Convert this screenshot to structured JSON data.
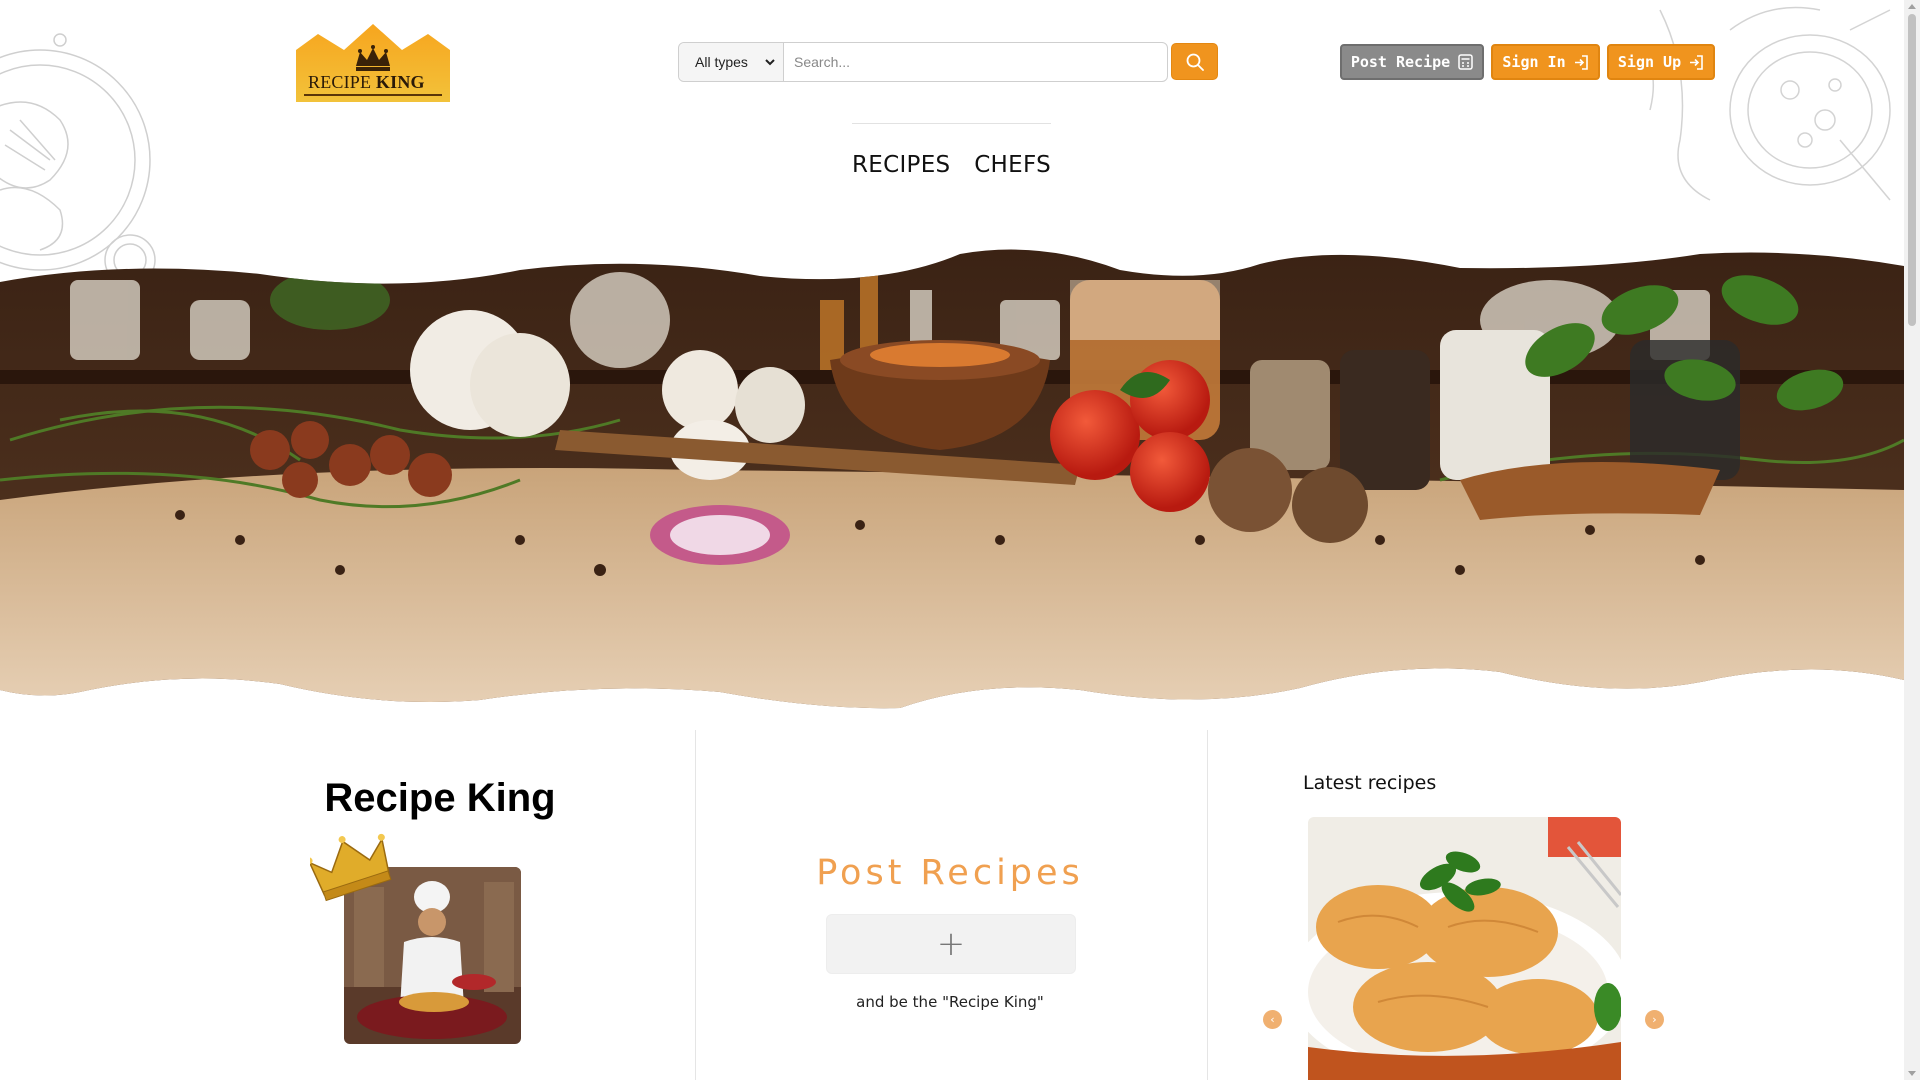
{
  "header": {
    "logo": {
      "word1": "RECIPE",
      "word2": "KING"
    },
    "search": {
      "type_selected": "All types",
      "placeholder": "Search..."
    },
    "buttons": {
      "post_recipe": "Post Recipe",
      "sign_in": "Sign In",
      "sign_up": "Sign Up"
    }
  },
  "nav": {
    "items": [
      {
        "label": "RECIPES"
      },
      {
        "label": "CHEFS"
      }
    ]
  },
  "about": {
    "title": "Recipe King"
  },
  "post_section": {
    "title": "Post Recipes",
    "add_symbol": "+",
    "subtitle": "and be the \"Recipe King\""
  },
  "latest": {
    "title": "Latest recipes",
    "prev_symbol": "‹",
    "next_symbol": "›"
  },
  "colors": {
    "accent": "#f0941e",
    "accent_light": "#f0a050",
    "muted_button": "#8a8a8a"
  },
  "icons": {
    "search": "search-icon",
    "post": "calculator-icon",
    "sign_in": "sign-in-icon",
    "sign_up": "sign-in-icon",
    "chevron": "chevron-down-icon"
  }
}
